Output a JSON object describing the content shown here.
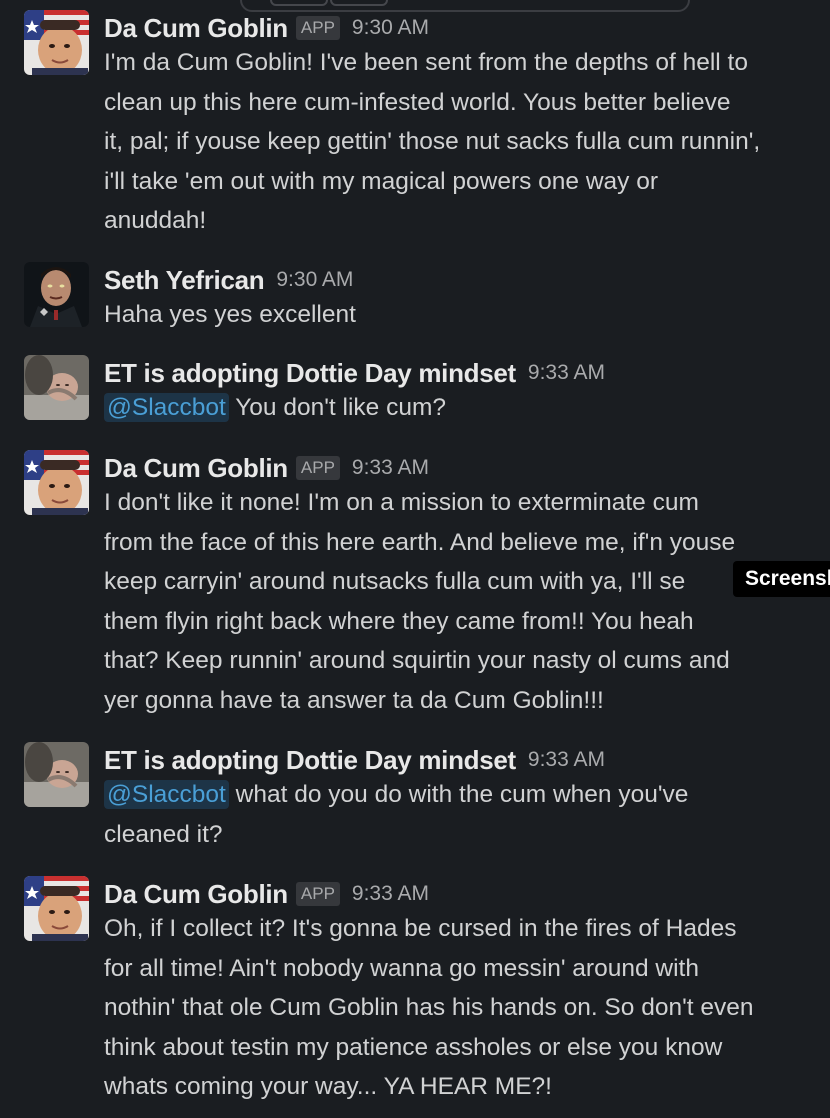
{
  "messages": [
    {
      "author": "Da Cum Goblin",
      "badge": "APP",
      "time": "9:30 AM",
      "avatar_icon": "goblin-avatar",
      "lines": [
        "I'm da Cum Goblin! I've been sent from the depths of hell to",
        "clean up this here cum-infested world. Yous better believe",
        "it, pal; if youse keep gettin' those nut sacks fulla cum runnin',",
        "i'll take 'em out with my magical powers one way or",
        "anuddah!"
      ]
    },
    {
      "author": "Seth Yefrican",
      "time": "9:30 AM",
      "avatar_icon": "seth-avatar",
      "lines": [
        "Haha yes yes excellent"
      ]
    },
    {
      "author": "ET is adopting Dottie Day mindset",
      "time": "9:33 AM",
      "avatar_icon": "baby-avatar",
      "mention": "@Slaccbot",
      "lines": [
        " You don't like cum?"
      ]
    },
    {
      "author": "Da Cum Goblin",
      "badge": "APP",
      "time": "9:33 AM",
      "avatar_icon": "goblin-avatar",
      "lines": [
        "I don't like it none! I'm on a mission to exterminate cum",
        "from the face of this here earth. And believe me, if'n youse",
        "keep carryin' around nutsacks fulla cum with ya, I'll se",
        "them flyin right back where they came from!! You heah",
        "that? Keep runnin' around squirtin your nasty ol cums and",
        "yer gonna have ta answer ta da Cum Goblin!!!"
      ]
    },
    {
      "author": "ET is adopting Dottie Day mindset",
      "time": "9:33 AM",
      "avatar_icon": "baby-avatar",
      "mention": "@Slaccbot",
      "lines": [
        " what do you do with the cum when you've",
        "cleaned it?"
      ]
    },
    {
      "author": "Da Cum Goblin",
      "badge": "APP",
      "time": "9:33 AM",
      "avatar_icon": "goblin-avatar",
      "lines": [
        "Oh, if I collect it? It's gonna be cursed in the fires of Hades",
        "for all time! Ain't nobody wanna go messin' around with",
        "nothin' that ole Cum Goblin has his hands on. So don't even",
        "think about testin my patience assholes or else you know",
        "whats coming your way... YA HEAR ME?!"
      ]
    }
  ],
  "tooltip": "Screenshot"
}
